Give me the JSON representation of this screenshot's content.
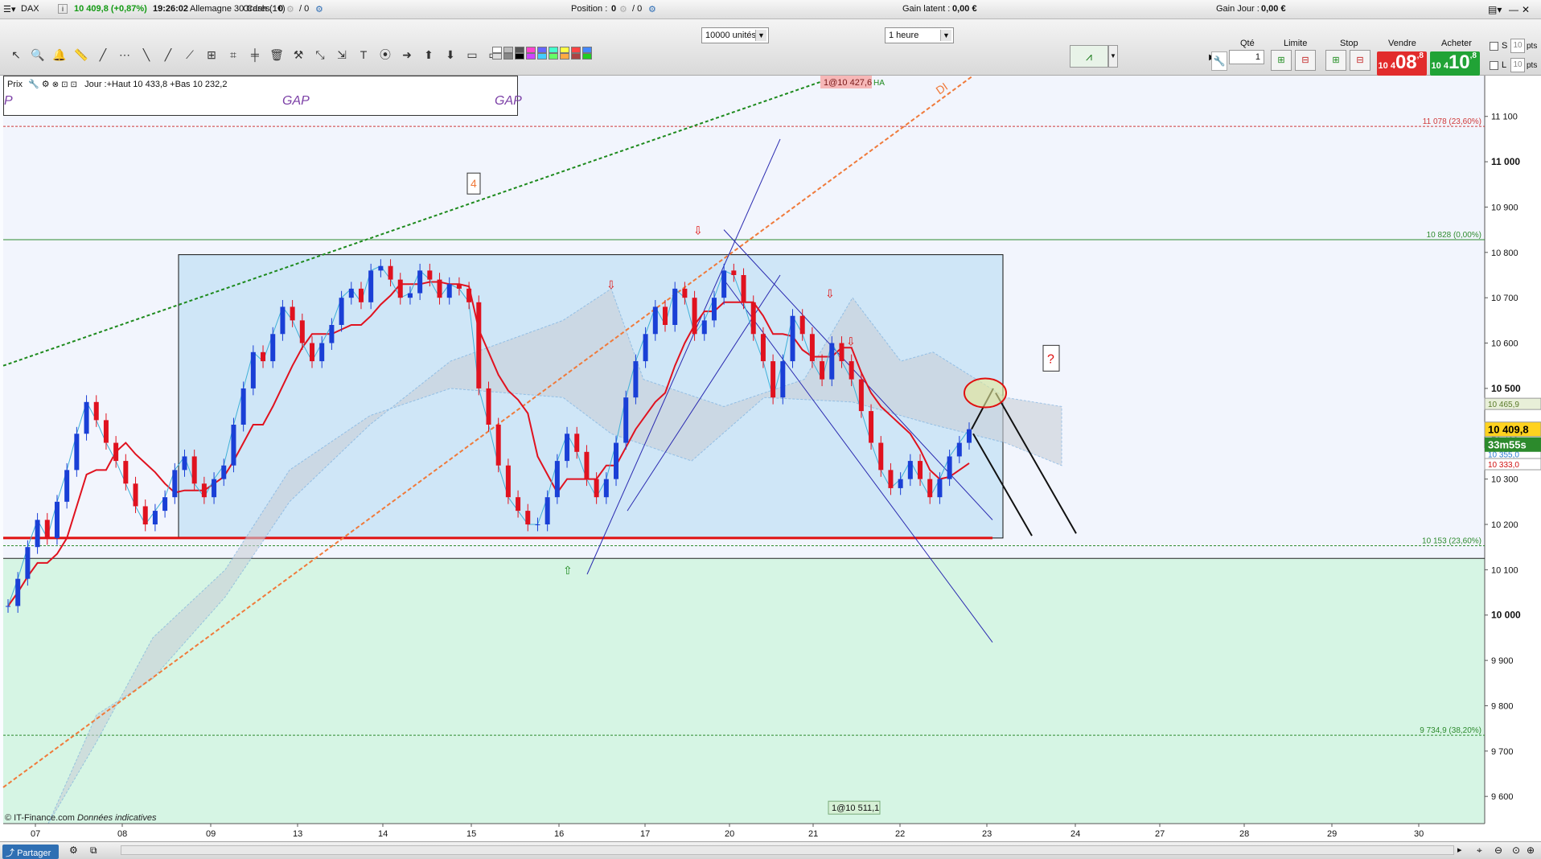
{
  "topbar": {
    "instrument": "DAX",
    "info_icon": "i",
    "price_change": "10 409,8 (+0,87%)",
    "time": "19:26:02",
    "description": "Allemagne 30 Cash (1€)",
    "orders_label": "Ordres :",
    "orders_value": "0",
    "orders_sep": "/ 0",
    "position_label": "Position :",
    "position_value": "0",
    "position_sep": "/ 0",
    "gain_latent_label": "Gain latent :",
    "gain_latent_value": "0,00 €",
    "gain_jour_label": "Gain Jour :",
    "gain_jour_value": "0,00 €"
  },
  "toolbar": {
    "units_select": "10000 unités",
    "interval_select": "1 heure",
    "qty_label": "Qté",
    "qty_value": "1",
    "limit_label": "Limite",
    "stop_label": "Stop",
    "sell_label": "Vendre",
    "buy_label": "Acheter",
    "sell_small": "10 4",
    "sell_big": "08",
    "sell_sup": ",8",
    "buy_small": "10 4",
    "buy_big": "10",
    "buy_sup": ",8",
    "s_label": "S",
    "l_label": "L",
    "s_value": "10",
    "l_value": "10",
    "pts": "pts"
  },
  "legend": {
    "prix": "Prix",
    "day_info": "Jour :+Haut 10 433,8 +Bas 10 232,2",
    "p_label": "P",
    "gap1": "GAP",
    "gap2": "GAP"
  },
  "annotations": {
    "top_tag": "1@10 427,6",
    "top_tag_suffix": "HA",
    "di_label": "DI",
    "wave_label": "4",
    "question": "?",
    "bottom_tag": "1@10 511,1"
  },
  "footer": {
    "credit": "© IT-Finance.com",
    "credit_italic": "Données indicatives",
    "share": "Partager"
  },
  "colors": {
    "bull": "#1a3fd6",
    "bear": "#e0121f",
    "rect_fill": "#cfe6f7",
    "green_zone": "#d6f5e4",
    "cloud": "#c9cfd8"
  },
  "chart_data": {
    "type": "line",
    "title": "",
    "ylim": [
      9540,
      11190
    ],
    "y_ticks": [
      "11 100",
      "11 000",
      "10 900",
      "10 800",
      "10 700",
      "10 600",
      "10 500",
      "10 400",
      "10 300",
      "10 200",
      "10 100",
      "10 000",
      "9 900",
      "9 800",
      "9 700",
      "9 600"
    ],
    "y_tick_values": [
      11100,
      11000,
      10900,
      10800,
      10700,
      10600,
      10500,
      10400,
      10300,
      10200,
      10100,
      10000,
      9900,
      9800,
      9700,
      9600
    ],
    "x_tick_labels": [
      "07",
      "08",
      "09",
      "13",
      "14",
      "15",
      "16",
      "17",
      "20",
      "21",
      "22",
      "23",
      "24",
      "27",
      "28",
      "29",
      "30"
    ],
    "price_badges": [
      {
        "value": 10465.9,
        "label": "10 465,9",
        "color": "#e8efd8",
        "text": "#5a7a2a"
      },
      {
        "value": 10409.8,
        "label": "10 409,8",
        "color": "#ffd21f",
        "text": "#000000"
      },
      {
        "value": 10355.0,
        "label": "10 355,0",
        "color": "#ffffff",
        "text": "#2b7bd0"
      },
      {
        "value": 10333.0,
        "label": "10 333,0",
        "color": "#ffffff",
        "text": "#d01010"
      }
    ],
    "countdown": "33m55s",
    "fib_levels": [
      {
        "value": 11078,
        "label": "11 078 (23,60%)",
        "color": "#d03a3a"
      },
      {
        "value": 10828,
        "label": "10 828 (0,00%)",
        "color": "#2e8b2e"
      },
      {
        "value": 10153,
        "label": "10 153 (23,60%)",
        "color": "#2e8b2e"
      },
      {
        "value": 9734.9,
        "label": "9 734,9 (38,20%)",
        "color": "#2e8b2e"
      }
    ],
    "support": 10170,
    "support_line2": 10125,
    "range_box": {
      "top": 10795,
      "bottom": 10170
    },
    "series": [
      {
        "values": [
          10020,
          10080,
          10150,
          10210,
          10170,
          10250,
          10320,
          10400,
          10470,
          10430,
          10380,
          10340,
          10290,
          10240,
          10200,
          10230,
          10260,
          10320,
          10350,
          10290,
          10260,
          10300,
          10330,
          10420,
          10500,
          10580,
          10560,
          10620,
          10680,
          10650,
          10600,
          10560,
          10600,
          10640,
          10700,
          10720,
          10690,
          10760,
          10770,
          10740,
          10700,
          10710,
          10760,
          10740,
          10700,
          10730,
          10720,
          10690,
          10500,
          10420,
          10330,
          10260,
          10230,
          10200,
          10200,
          10260,
          10340,
          10400,
          10360,
          10300,
          10260,
          10300,
          10380,
          10480,
          10560,
          10620,
          10680,
          10640,
          10720,
          10700,
          10620,
          10650,
          10700,
          10760,
          10750,
          10690,
          10620,
          10560,
          10480,
          10560,
          10660,
          10620,
          10560,
          10520,
          10600,
          10560,
          10520,
          10450,
          10380,
          10320,
          10280,
          10300,
          10340,
          10300,
          10260,
          10300,
          10350,
          10380,
          10410
        ]
      }
    ]
  }
}
